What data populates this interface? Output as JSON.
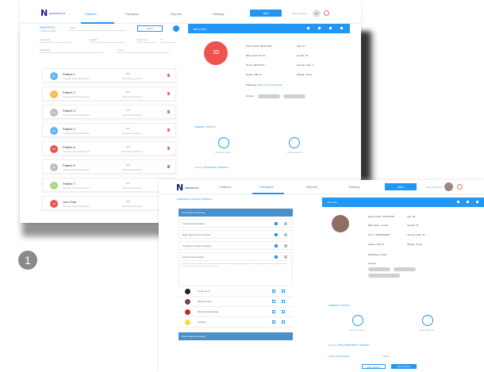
{
  "step": "1",
  "app": {
    "logo": "N",
    "logo_text": "NEPHROVIA"
  },
  "window1": {
    "nav": [
      "Patients",
      "Therapies",
      "Reports",
      "Settings"
    ],
    "add_label": "Add",
    "user_name": "Hans Wiedner",
    "user_initials": "Hw",
    "patients_title": "PATIENTS",
    "patients_subtitle": "7 Patients 2017",
    "search_placeholder": "Seek",
    "filter_label": "Filters",
    "filters": [
      "Lab name",
      "Gender",
      "Age From",
      "To",
      "Pathology",
      "Group"
    ],
    "patients": [
      {
        "name": "Patient 1",
        "initials": "P1",
        "color": "#64b5f6",
        "therapy": "Therapy Chemotherapy 1",
        "count": "0/4",
        "sessions": "Executed sessions"
      },
      {
        "name": "Patient 2",
        "initials": "P2",
        "color": "#ffb74d",
        "therapy": "Therapy Chemotherapy 2",
        "count": "2/4",
        "sessions": "Executed sessions"
      },
      {
        "name": "Patient 3",
        "initials": "P3",
        "color": "#bdbdbd",
        "therapy": "Therapy Chemotherapy 3",
        "count": "1/4",
        "sessions": "Executed sessions"
      },
      {
        "name": "Patient 4",
        "initials": "P4",
        "color": "#64b5f6",
        "therapy": "Therapy Chemotherapy 4",
        "count": "3/4",
        "sessions": "Executed sessions"
      },
      {
        "name": "Patient 5",
        "initials": "P5",
        "color": "#ef5350",
        "therapy": "Therapy Chemotherapy 5",
        "count": "4/4",
        "sessions": "Executed sessions"
      },
      {
        "name": "Patient 6",
        "initials": "P6",
        "color": "#bdbdbd",
        "therapy": "Therapy Chemotherapy 6",
        "count": "0/4",
        "sessions": "Executed sessions"
      },
      {
        "name": "Patient 7",
        "initials": "P7",
        "color": "#aed581",
        "therapy": "Therapy Chemotherapy 7",
        "count": "2/4",
        "sessions": "Executed sessions"
      },
      {
        "name": "John Doe",
        "initials": "JD",
        "color": "#ef5350",
        "therapy": "Therapy Chemotherapy 8",
        "count": "3/4",
        "sessions": "Executed sessions"
      }
    ],
    "detail": {
      "header": "John Doe",
      "initials": "JD",
      "fields": [
        {
          "label": "Date of birth",
          "value": "02/01/1967"
        },
        {
          "label": "Age",
          "value": "50"
        },
        {
          "label": "Birth place",
          "value": "Trento"
        },
        {
          "label": "Gender",
          "value": "M"
        },
        {
          "label": "Tax id",
          "value": "JDOXXXX"
        },
        {
          "label": "Internal code",
          "value": "4"
        },
        {
          "label": "Height",
          "value": "180 cm"
        },
        {
          "label": "Weight",
          "value": "70 Kg"
        }
      ],
      "pathology_label": "Pathology",
      "pathology_value": "Mel colon, Intestinemal",
      "groups_label": "Groups",
      "status_title": "THERAPY STATUS",
      "done_label": "Sessions done",
      "todo_label": "Daily sessions",
      "therapy_label": "Therapy",
      "therapy_value": "STANDARD THERAPY"
    }
  },
  "window2": {
    "nav": [
      "Patients",
      "Therapies",
      "Reports",
      "Settings"
    ],
    "add_label": "Add",
    "user_name": "Hans de Boolet",
    "breadcrumb": "THERAPIES | PATIENT DETAILS",
    "pre_header": "Pre-treatment therapy",
    "items": [
      "Lower limbs session",
      "Right upper limb exercises",
      "Cognitive functions training",
      "Upper limbs session"
    ],
    "description": "This exercise session involves upper limbs movements aimed at restoring grasping. Following a series of dynamic movements and cognitive activities. The patient is instructed to lead the rotation exercises.",
    "exercises": [
      {
        "name": "Count up to",
        "color": "#212121"
      },
      {
        "name": "Tap the mole",
        "color": "#6d4c41"
      },
      {
        "name": "Discover landscape",
        "color": "#c62828"
      },
      {
        "name": "Cooking",
        "color": "#fdd835"
      }
    ],
    "post_header": "Post-treatment therapy",
    "detail": {
      "header": "John Doe",
      "fields": [
        {
          "label": "Date of birth",
          "value": "07/02/1949"
        },
        {
          "label": "Age",
          "value": "68"
        },
        {
          "label": "Birth place",
          "value": "London"
        },
        {
          "label": "Gender",
          "value": "M"
        },
        {
          "label": "Tax id",
          "value": "JDPR000000"
        },
        {
          "label": "Internal code",
          "value": "40"
        },
        {
          "label": "Height",
          "value": "175 cm"
        },
        {
          "label": "Weight",
          "value": "70 Kg"
        }
      ],
      "pathology_label": "Pathology",
      "pathology_value": "Stroke",
      "groups_label": "Groups",
      "status_title": "THERAPY STATUS",
      "done_label": "Sessions done",
      "todo_label": "Daily sessions",
      "therapy_label": "Therapy",
      "therapy_value": "PRE-TREATMENT THERAPY",
      "session_label": "Upper limbs session",
      "session_state": "Done",
      "edit_label": "Edit therapy",
      "start_label": "Start session"
    }
  }
}
